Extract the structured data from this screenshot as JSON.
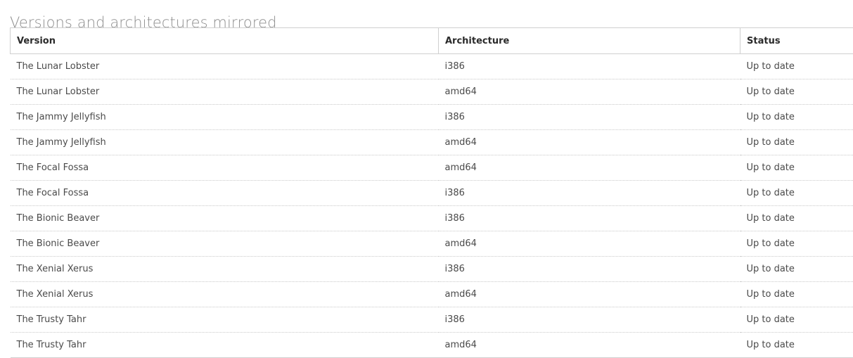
{
  "page": {
    "title": "Versions and architectures mirrored"
  },
  "table": {
    "columns": [
      {
        "key": "version",
        "label": "Version"
      },
      {
        "key": "architecture",
        "label": "Architecture"
      },
      {
        "key": "status",
        "label": "Status"
      }
    ],
    "rows": [
      {
        "version": "The Lunar Lobster",
        "architecture": "i386",
        "status": "Up to date"
      },
      {
        "version": "The Lunar Lobster",
        "architecture": "amd64",
        "status": "Up to date"
      },
      {
        "version": "The Jammy Jellyfish",
        "architecture": "i386",
        "status": "Up to date"
      },
      {
        "version": "The Jammy Jellyfish",
        "architecture": "amd64",
        "status": "Up to date"
      },
      {
        "version": "The Focal Fossa",
        "architecture": "amd64",
        "status": "Up to date"
      },
      {
        "version": "The Focal Fossa",
        "architecture": "i386",
        "status": "Up to date"
      },
      {
        "version": "The Bionic Beaver",
        "architecture": "i386",
        "status": "Up to date"
      },
      {
        "version": "The Bionic Beaver",
        "architecture": "amd64",
        "status": "Up to date"
      },
      {
        "version": "The Xenial Xerus",
        "architecture": "i386",
        "status": "Up to date"
      },
      {
        "version": "The Xenial Xerus",
        "architecture": "amd64",
        "status": "Up to date"
      },
      {
        "version": "The Trusty Tahr",
        "architecture": "i386",
        "status": "Up to date"
      },
      {
        "version": "The Trusty Tahr",
        "architecture": "amd64",
        "status": "Up to date"
      }
    ]
  },
  "colors": {
    "title": "#8d8d8d",
    "header_text": "#2b2b2b",
    "body_text": "#4a4a4a",
    "status_ok": "#6d8f3f",
    "border_solid": "#cfcfcf",
    "border_dotted": "#c9c9c9"
  }
}
